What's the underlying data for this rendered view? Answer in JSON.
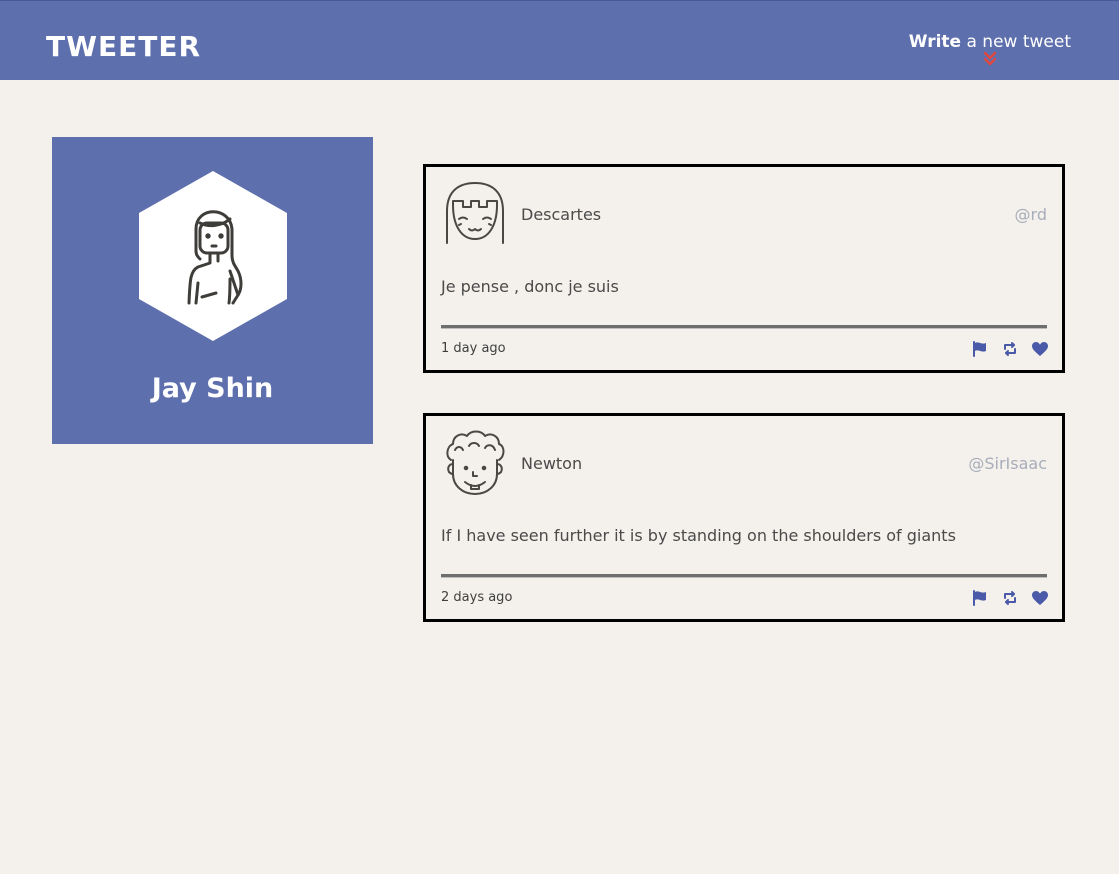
{
  "nav": {
    "brand": "TWEETER",
    "compose_strong": "Write",
    "compose_rest": " a new tweet",
    "chevron_color": "#e3473f"
  },
  "profile": {
    "name": "Jay Shin"
  },
  "tweets": [
    {
      "name": "Descartes",
      "handle": "@rd",
      "content": "Je pense , donc je suis",
      "time": "1 day ago",
      "avatar_icon": "girl-avatar-icon"
    },
    {
      "name": "Newton",
      "handle": "@SirIsaac",
      "content": "If I have seen further it is by standing on the shoulders of giants",
      "time": "2 days ago",
      "avatar_icon": "curly-hair-avatar-icon"
    }
  ],
  "icons": {
    "flag": "flag-icon",
    "retweet": "retweet-icon",
    "like": "heart-icon"
  },
  "colors": {
    "brand": "#5e6fad",
    "background": "#f4f1ec",
    "handle": "#a8adba",
    "action_icons": "#4a5aa8"
  }
}
